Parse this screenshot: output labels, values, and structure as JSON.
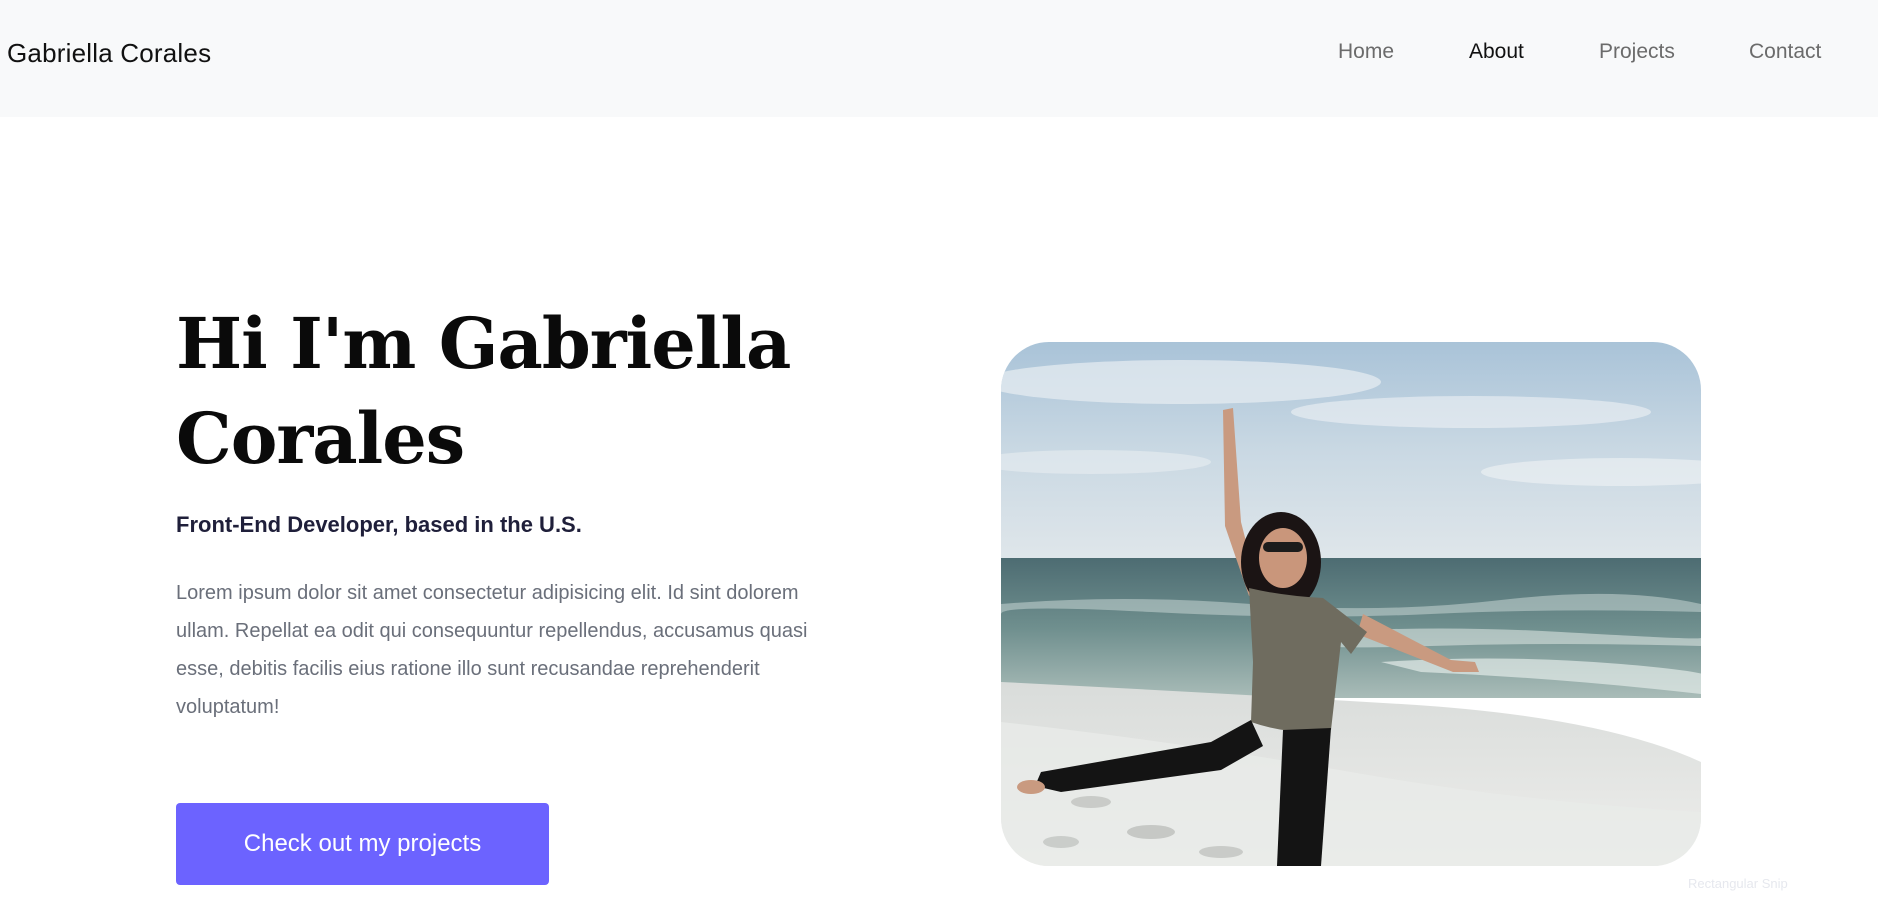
{
  "header": {
    "brand": "Gabriella Corales",
    "nav": [
      {
        "label": "Home",
        "active": false
      },
      {
        "label": "About",
        "active": true
      },
      {
        "label": "Projects",
        "active": false
      },
      {
        "label": "Contact",
        "active": false
      }
    ]
  },
  "hero": {
    "title": "Hi I'm Gabriella Corales",
    "subtitle": "Front-End Developer, based in the U.S.",
    "description": "Lorem ipsum dolor sit amet consectetur adipisicing elit. Id sint dolorem ullam. Repellat ea odit qui consequuntur repellendus, accusamus quasi esse, debitis facilis eius ratione illo sunt recusandae reprehenderit voluptatum!",
    "cta_label": "Check out my projects"
  },
  "overlay": {
    "hint": "Rectangular Snip"
  },
  "colors": {
    "accent": "#6c63ff",
    "navbar_bg": "#f8f9fa",
    "nav_inactive": "#6b6b6b",
    "nav_active": "#111111"
  }
}
